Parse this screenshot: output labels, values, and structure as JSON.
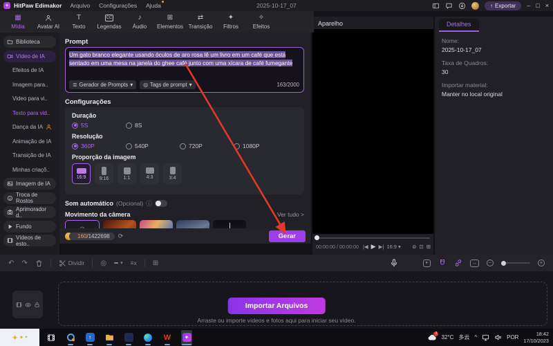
{
  "titlebar": {
    "app": "HitPaw Edimakor",
    "menu_arquivo": "Arquivo",
    "menu_config": "Configurações",
    "menu_ajuda": "Ajuda",
    "doc": "2025-10-17_07",
    "export": "Exportar"
  },
  "tabs": [
    "Mídia",
    "Avatar AI",
    "Texto",
    "Legendas",
    "Áudio",
    "Elementos",
    "Transição",
    "Filtros",
    "Efeitos"
  ],
  "sidebar": {
    "items": [
      "Biblioteca",
      "Vídeo de IA",
      "Efeitos de IA",
      "Imagem para..",
      "Video para vi..",
      "Texto para vid..",
      "Dança da IA",
      "Animação de IA",
      "Transição de IA",
      "Minhas criaçõ..",
      "Imagem de IA",
      "Troca de Rostos",
      "Aprimorador d..",
      "Fundo",
      "Vídeos de esto.."
    ]
  },
  "prompt": {
    "label": "Prompt",
    "text": "Um gato branco elegante usando óculos de aro rosa lê um livro em um café que está sentado em uma mesa na janela do ghee café junto com uma xícara de café fumegante",
    "generator": "Gerador de Prompts",
    "tags": "Tags de prompt",
    "counter": "163/2000"
  },
  "settings": {
    "title": "Configurações",
    "duracao": {
      "label": "Duração",
      "opt0": "5S",
      "opt1": "8S",
      "selected": "5S"
    },
    "resolucao": {
      "label": "Resolução",
      "opt0": "360P",
      "opt1": "540P",
      "opt2": "720P",
      "opt3": "1080P",
      "selected": "360P"
    },
    "proporcao": {
      "label": "Proporção da imagem",
      "opt0": "16:9",
      "opt1": "9:16",
      "opt2": "1:1",
      "opt3": "4:3",
      "opt4": "3:4",
      "selected": "16:9"
    },
    "som": {
      "label": "Som automático",
      "hint": "(Opcional)",
      "state": "off"
    },
    "camera": {
      "label": "Movimento da câmera",
      "ver_tudo": "Ver tudo"
    }
  },
  "generate": {
    "credits_used": "160",
    "credits_total": "/1422698",
    "button": "Gerar"
  },
  "preview": {
    "title": "Aparelho",
    "time": "00:00:00 / 00:00:00",
    "ratio": "16:9"
  },
  "details": {
    "tab": "Detalhes",
    "f0_label": "Nome:",
    "f0_value": "2025-10-17_07",
    "f1_label": "Taxa de Quadros:",
    "f1_value": "30",
    "f2_label": "Importar material:",
    "f2_value": "Manter no local original"
  },
  "timeline": {
    "dividir": "Dividir",
    "import_btn": "Importar Arquivos",
    "hint": "Arraste ou importe vídeos e fotos aqui para iniciar seu vídeo."
  },
  "taskbar": {
    "temp": "32°C",
    "weather": "多云",
    "lang": "POR",
    "time": "18:42",
    "date": "17/10/2023",
    "badge": "1"
  },
  "icons": {
    "dropdown": "▾",
    "chevron_right": ">",
    "info": "ⓘ",
    "undo": "↶",
    "redo": "↷",
    "prev_frame": "|◀",
    "play": "▶",
    "next_frame": "▶|",
    "snapshot": "⊚",
    "crop": "⊡",
    "fullscreen": "⊞",
    "zoom_out": "−",
    "zoom_in": "+",
    "refresh": "⟳",
    "export": "↑",
    "minimize": "–",
    "maximize": "□",
    "close": "×",
    "music": "♪",
    "elements": "⊞",
    "transition": "⇄",
    "filters": "✦",
    "effects": "✧",
    "media": "▦",
    "text_tool": "T",
    "captions": "CC",
    "tray_caret": "^",
    "generator": "≣",
    "tags": "◎",
    "badge": "◎",
    "subtitle_x": "≡x",
    "add_frame": "⊞",
    "none": "⊘",
    "wps": "W",
    "sparkle": "✦",
    "ripple": "↔"
  },
  "colors": {
    "accent": "#a15fe0",
    "gerar_button": "#9c3fe8",
    "selection": "#6d5494",
    "arrow": "#e0392b",
    "coin": "#e8a33d",
    "taskbar_indicator": "#5aa0e8"
  }
}
